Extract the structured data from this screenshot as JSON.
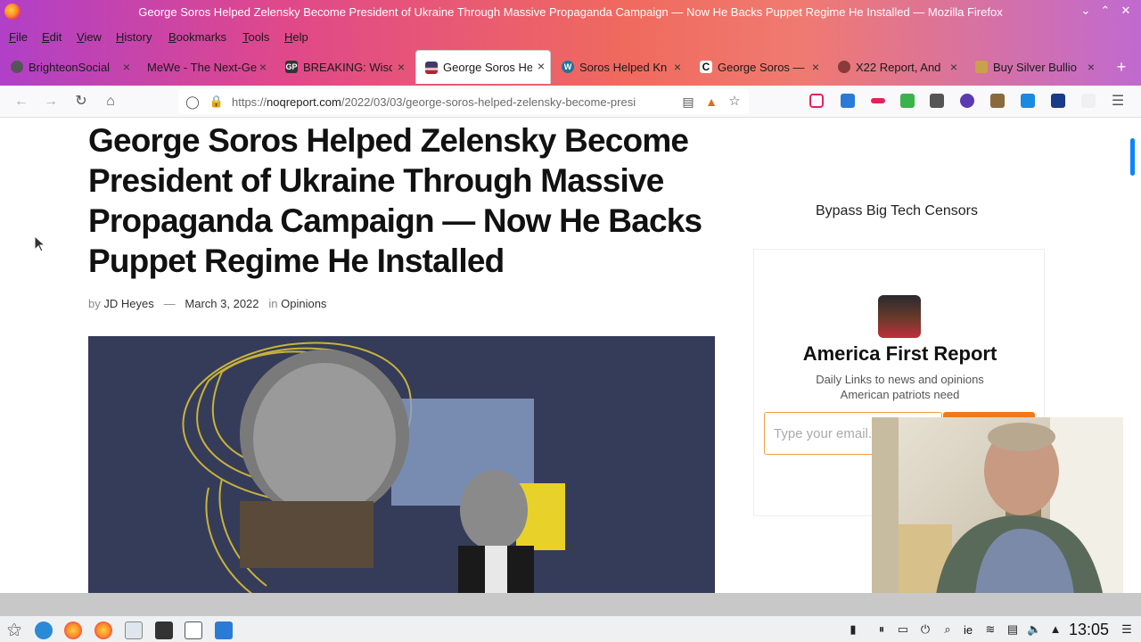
{
  "window": {
    "title": "George Soros Helped Zelensky Become President of Ukraine Through Massive Propaganda Campaign — Now He Backs Puppet Regime He Installed — Mozilla Firefox"
  },
  "menu": [
    "File",
    "Edit",
    "View",
    "History",
    "Bookmarks",
    "Tools",
    "Help"
  ],
  "tabs": [
    {
      "label": "BrighteonSocial",
      "active": false,
      "icon": "brighteon-icon",
      "color": "#555555"
    },
    {
      "label": "MeWe - The Next-Ge",
      "active": false,
      "icon": "mewe-icon",
      "color": "#00000000"
    },
    {
      "label": "BREAKING: Wisc",
      "active": false,
      "icon": "gp-icon",
      "color": "#333333"
    },
    {
      "label": "George Soros He",
      "active": true,
      "icon": "flag-icon",
      "color": "#b22234"
    },
    {
      "label": "Soros Helped Kn",
      "active": false,
      "icon": "wordpress-icon",
      "color": "#21759b"
    },
    {
      "label": "George Soros —",
      "active": false,
      "icon": "c-icon",
      "color": "#111111"
    },
    {
      "label": "X22 Report, And",
      "active": false,
      "icon": "x22-icon",
      "color": "#8a3a3a"
    },
    {
      "label": "Buy Silver Bullio",
      "active": false,
      "icon": "silver-icon",
      "color": "#c8a24a"
    }
  ],
  "nav": {
    "url_prefix": "https://",
    "url_domain": "noqreport.com",
    "url_path": "/2022/03/03/george-soros-helped-zelensky-become-presi"
  },
  "article": {
    "headline": "George Soros Helped Zelensky Become President of Ukraine Through Massive Propaganda Campaign — Now He Backs Puppet Regime He Installed",
    "by": "by",
    "author": "JD Heyes",
    "dash": "—",
    "date": "March 3, 2022",
    "in": "in",
    "category": "Opinions"
  },
  "sidebar": {
    "heading": "Bypass Big Tech Censors",
    "widget_title": "America First Report",
    "widget_sub": "Daily Links to news and opinions American patriots need",
    "email_placeholder": "Type your email..."
  },
  "taskbar": {
    "keyboard": "ie",
    "clock": "13:05"
  },
  "colors": {
    "accent": "#f07a1a",
    "link": "#0a84ff",
    "hero_bg": "#353c5a"
  }
}
